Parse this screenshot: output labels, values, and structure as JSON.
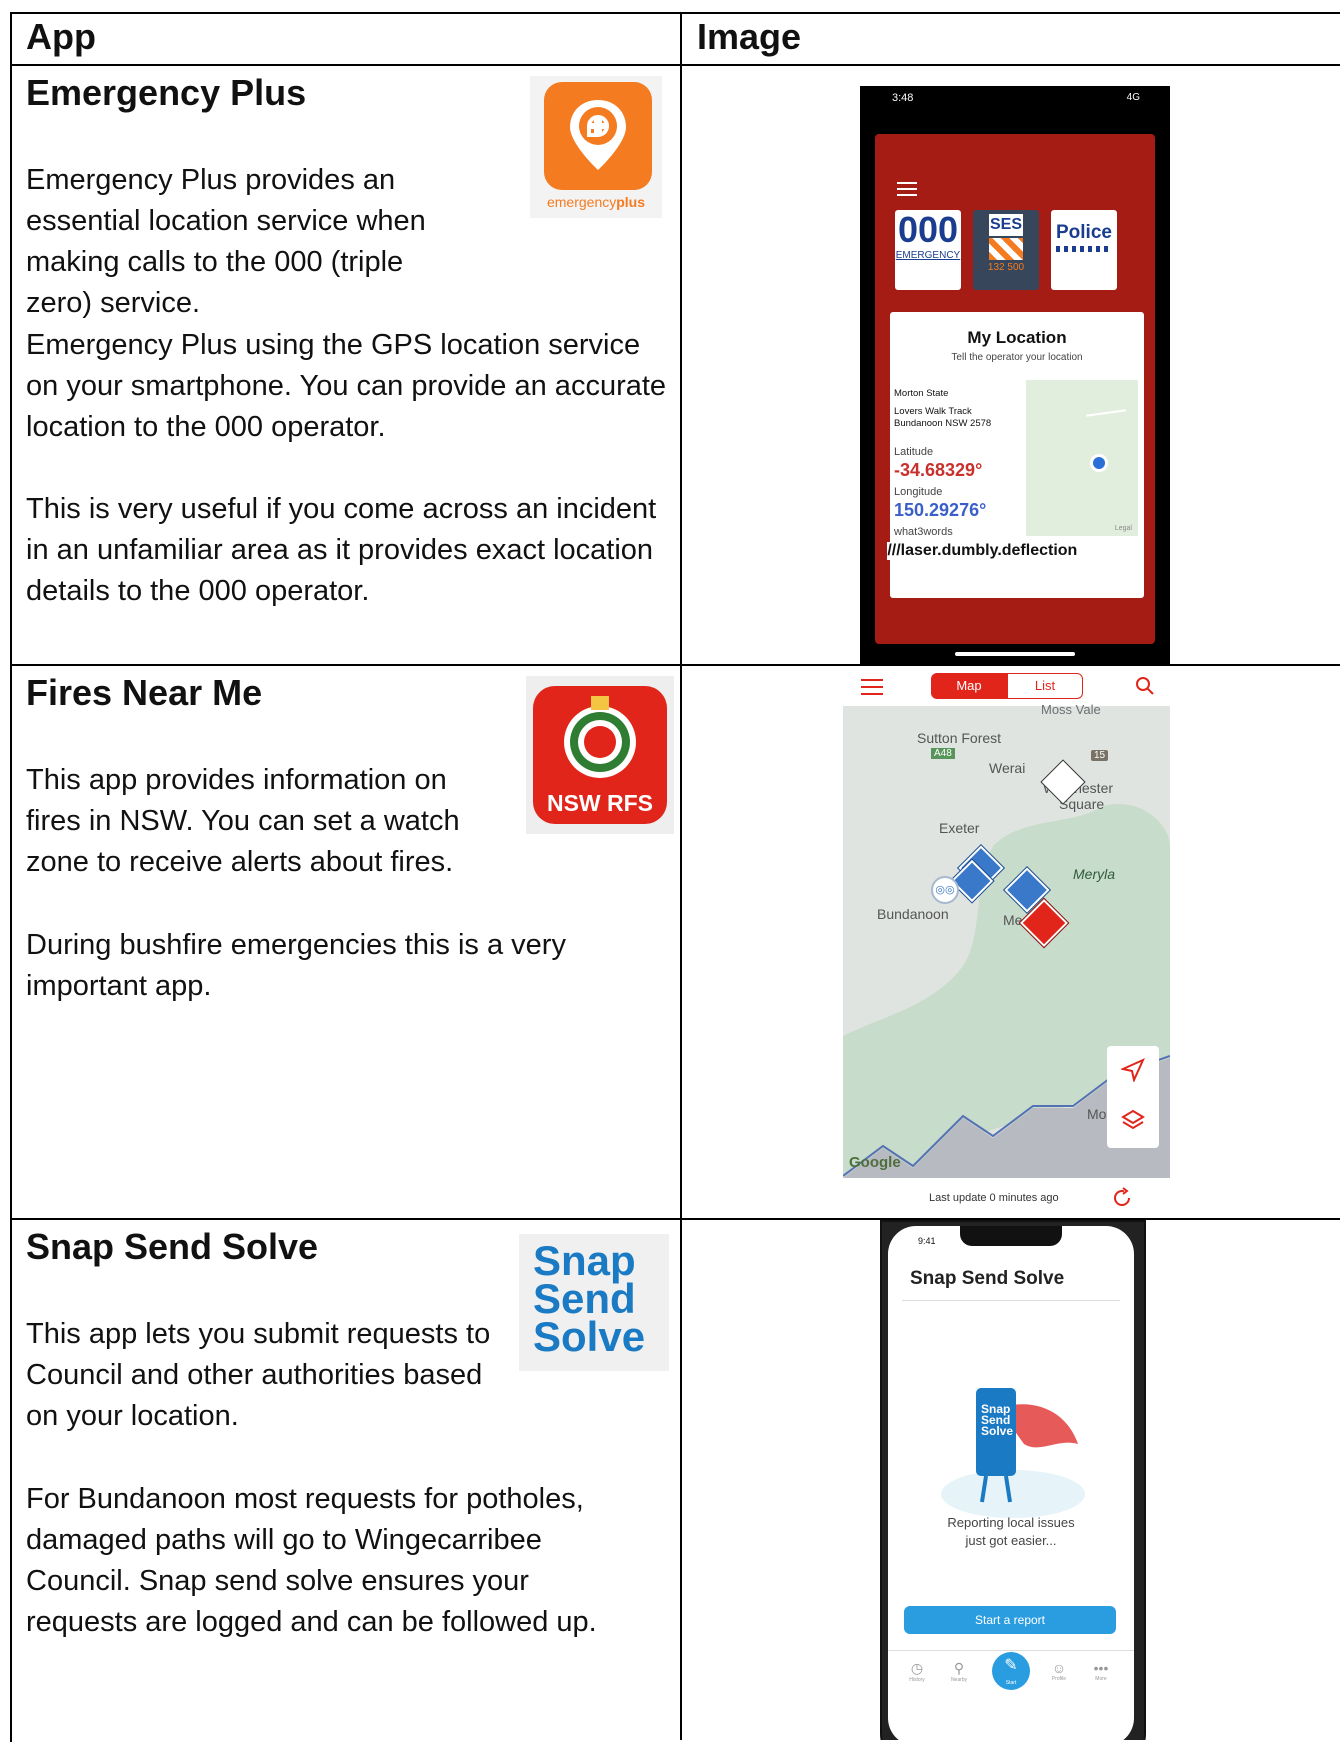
{
  "table": {
    "headers": {
      "app": "App",
      "image": "Image"
    }
  },
  "rows": [
    {
      "title": "Emergency Plus",
      "paragraphs": [
        "Emergency Plus provides an essential location service when making calls to the 000 (triple zero) service.",
        "Emergency Plus using the GPS location service on your smartphone. You can provide an accurate location to the 000 operator.",
        "This is very useful if you come across an incident in an unfamiliar area as it provides exact location details to the 000 operator."
      ],
      "logo": {
        "text_a": "emergency",
        "text_b": "plus",
        "color": "#f47b20"
      },
      "screenshot": {
        "time": "3:48",
        "network": "4G",
        "tiles": {
          "t000": "000",
          "t000_sub": "EMERGENCY",
          "ses": "SES",
          "ses_sub": "132 500",
          "police": "Police"
        },
        "card_title": "My Location",
        "card_subtitle": "Tell the operator your location",
        "address": [
          "Morton State",
          "Lovers Walk Track",
          "Bundanoon NSW 2578"
        ],
        "lat_label": "Latitude",
        "lat": "-34.68329°",
        "lon_label": "Longitude",
        "lon": "150.29276°",
        "w3w_label": "what3words",
        "w3w": "///laser.dumbly.deflection",
        "legal": "Legal"
      }
    },
    {
      "title": "Fires Near Me",
      "paragraphs": [
        "This app provides information on fires in NSW. You can set a watch zone to receive alerts about fires.",
        "During bushfire emergencies this is a very important app."
      ],
      "logo": {
        "text": "NSW RFS",
        "color": "#e1251b"
      },
      "screenshot": {
        "tab_map": "Map",
        "tab_list": "List",
        "places": {
          "moss_vale": "Moss Vale",
          "sutton_forest": "Sutton Forest",
          "a48": "A48",
          "werai": "Werai",
          "r15": "15",
          "winchester": "Winchester",
          "square": "Square",
          "exeter": "Exeter",
          "meryla": "Meryla",
          "bundanoon": "Bundanoon",
          "me": "Me",
          "moc": "Moc"
        },
        "google": "Google",
        "last_update": "Last update 0 minutes ago"
      }
    },
    {
      "title": "Snap Send Solve",
      "paragraphs": [
        "This app lets you submit requests to Council and other authorities based on your location.",
        "For Bundanoon most requests for potholes, damaged paths will go to Wingecarribee Council. Snap send solve ensures your requests are logged and can be followed up."
      ],
      "logo": {
        "lines": [
          "Snap",
          "Send",
          "Solve"
        ],
        "color": "#1a7ac4"
      },
      "screenshot": {
        "time": "9:41",
        "title": "Snap Send Solve",
        "phone_lines": [
          "Snap",
          "Send",
          "Solve"
        ],
        "caption_1": "Reporting local issues",
        "caption_2": "just got easier...",
        "button": "Start a report",
        "nav": [
          "History",
          "Nearby",
          "Start",
          "Profile",
          "More"
        ]
      }
    }
  ]
}
